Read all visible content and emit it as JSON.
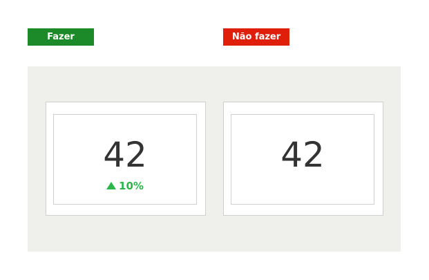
{
  "labels": {
    "do": "Fazer",
    "dont": "Não fazer"
  },
  "cards": {
    "left": {
      "value": "42",
      "delta_icon": "up-triangle",
      "delta_text": "10%",
      "delta_color": "#2bb54a"
    },
    "right": {
      "value": "42"
    }
  },
  "colors": {
    "do_label_bg": "#1d8a2a",
    "dont_label_bg": "#e01f0a",
    "panel_bg": "#efefeb",
    "text": "#333333"
  }
}
